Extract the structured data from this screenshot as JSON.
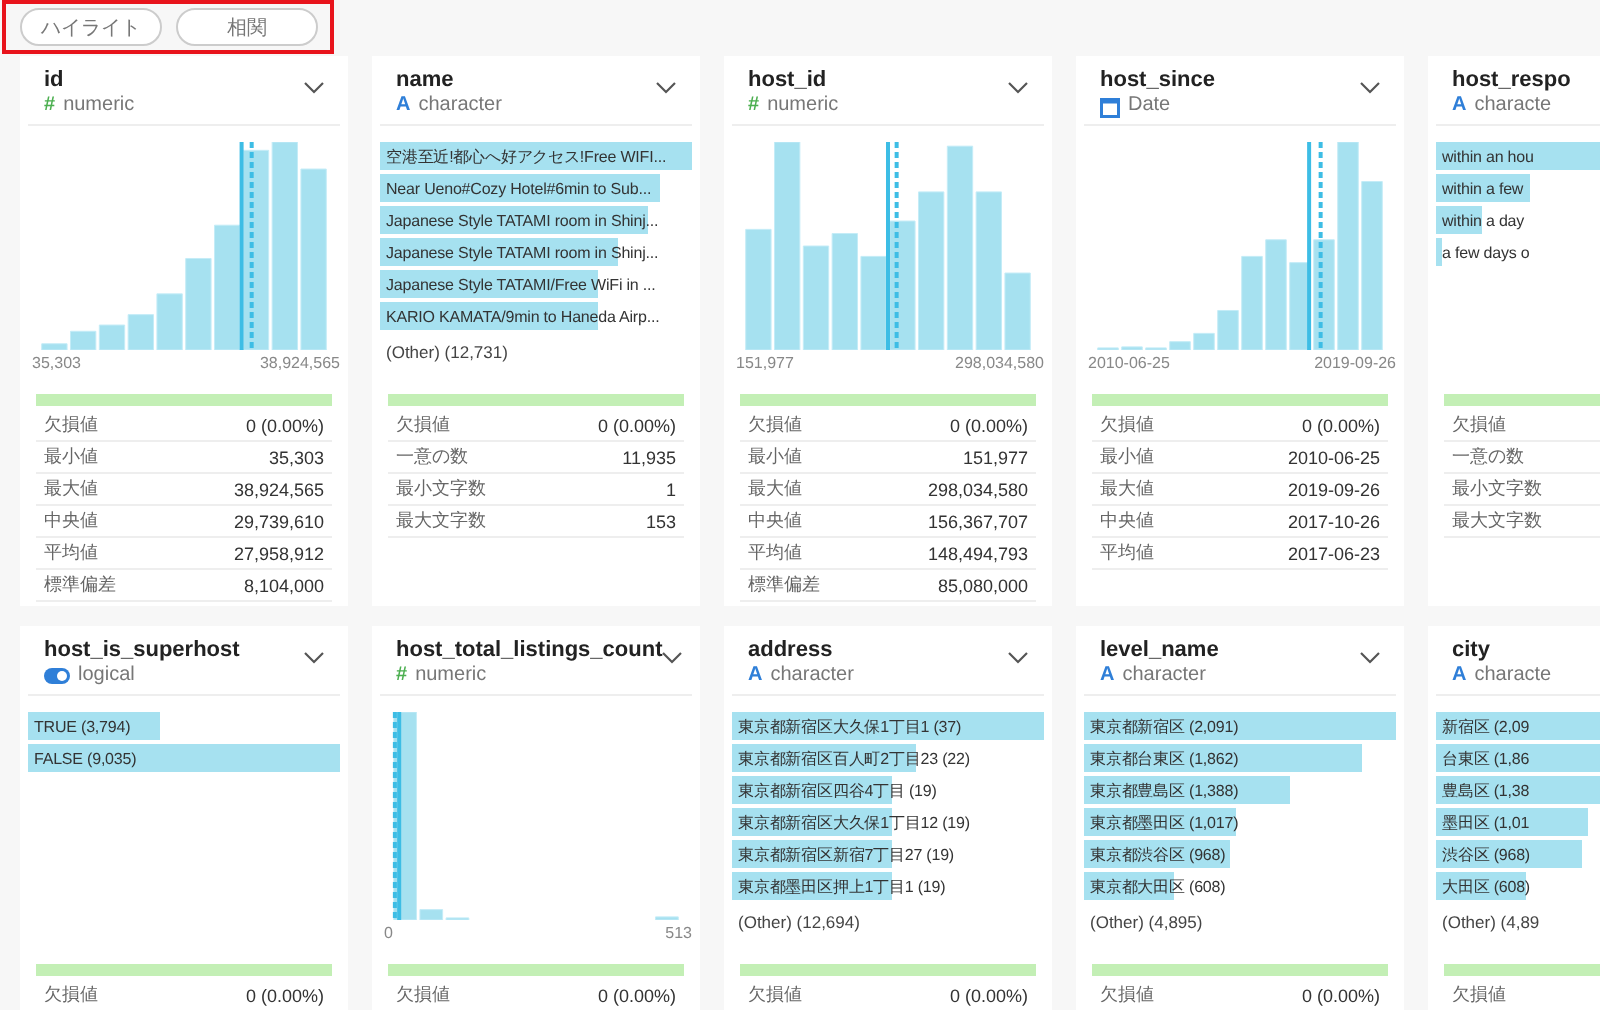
{
  "toolbar": {
    "buttons": [
      {
        "label": "ハイライト"
      },
      {
        "label": "相関"
      }
    ]
  },
  "rows": [
    [
      {
        "name": "id",
        "type": {
          "kind": "numeric",
          "icon": "#",
          "label": "numeric"
        },
        "kind": "histogram",
        "histogram": {
          "min_label": "35,303",
          "max_label": "38,924,565"
        },
        "completeness": {
          "level": 1
        },
        "stats": [
          {
            "label": "欠損値",
            "value": "0 (0.00%)"
          },
          {
            "label": "最小値",
            "value": "35,303"
          },
          {
            "label": "最大値",
            "value": "38,924,565"
          },
          {
            "label": "中央値",
            "value": "29,739,610"
          },
          {
            "label": "平均値",
            "value": "27,958,912"
          },
          {
            "label": "標準偏差",
            "value": "8,104,000"
          }
        ]
      },
      {
        "name": "name",
        "type": {
          "kind": "character",
          "icon": "A",
          "label": "character"
        },
        "kind": "categories",
        "categories": [
          {
            "label": "空港至近!都心へ好アクセス!Free WIFI...",
            "level": 1
          },
          {
            "label": "Near Ueno#Cozy Hotel#6min to Sub...",
            "level": 0.9
          },
          {
            "label": "Japanese Style TATAMI room in Shinj...",
            "level": 0.86
          },
          {
            "label": "Japanese Style TATAMI room in Shinj...",
            "level": 0.76
          },
          {
            "label": "Japanese Style TATAMI/Free WiFi in ...",
            "level": 0.7
          },
          {
            "label": "KARIO KAMATA/9min to Haneda Airp...",
            "level": 0.7
          }
        ],
        "other": "(Other) (12,731)",
        "completeness": {
          "level": 1
        },
        "stats": [
          {
            "label": "欠損値",
            "value": "0 (0.00%)"
          },
          {
            "label": "一意の数",
            "value": "11,935"
          },
          {
            "label": "最小文字数",
            "value": "1"
          },
          {
            "label": "最大文字数",
            "value": "153"
          }
        ]
      },
      {
        "name": "host_id",
        "type": {
          "kind": "numeric",
          "icon": "#",
          "label": "numeric"
        },
        "kind": "histogram",
        "histogram": {
          "min_label": "151,977",
          "max_label": "298,034,580"
        },
        "completeness": {
          "level": 1
        },
        "stats": [
          {
            "label": "欠損値",
            "value": "0 (0.00%)"
          },
          {
            "label": "最小値",
            "value": "151,977"
          },
          {
            "label": "最大値",
            "value": "298,034,580"
          },
          {
            "label": "中央値",
            "value": "156,367,707"
          },
          {
            "label": "平均値",
            "value": "148,494,793"
          },
          {
            "label": "標準偏差",
            "value": "85,080,000"
          }
        ]
      },
      {
        "name": "host_since",
        "type": {
          "kind": "date",
          "label": "Date"
        },
        "kind": "histogram",
        "histogram": {
          "min_label": "2010-06-25",
          "max_label": "2019-09-26"
        },
        "completeness": {
          "level": 1
        },
        "stats": [
          {
            "label": "欠損値",
            "value": "0 (0.00%)"
          },
          {
            "label": "最小値",
            "value": "2010-06-25"
          },
          {
            "label": "最大値",
            "value": "2019-09-26"
          },
          {
            "label": "中央値",
            "value": "2017-10-26"
          },
          {
            "label": "平均値",
            "value": "2017-06-23"
          }
        ]
      },
      {
        "name": "host_respo",
        "type": {
          "kind": "character",
          "icon": "A",
          "label": "characte"
        },
        "kind": "categories",
        "categories": [
          {
            "label": "within an hou",
            "level": 1
          },
          {
            "label": "within a few",
            "level": 0.3
          },
          {
            "label": "within a day",
            "level": 0.15
          },
          {
            "label": "a few days o",
            "level": 0.02
          }
        ],
        "completeness": {
          "level": 1
        },
        "stats": [
          {
            "label": "欠損値"
          },
          {
            "label": "一意の数"
          },
          {
            "label": "最小文字数"
          },
          {
            "label": "最大文字数"
          }
        ]
      }
    ],
    [
      {
        "name": "host_is_superhost",
        "type": {
          "kind": "logical",
          "label": "logical"
        },
        "kind": "categories",
        "categories": [
          {
            "label": "TRUE (3,794)",
            "level": 0.42
          },
          {
            "label": "FALSE (9,035)",
            "level": 1
          }
        ],
        "completeness": {
          "level": 1
        },
        "stats": [
          {
            "label": "欠損値",
            "value": "0 (0.00%)"
          }
        ]
      },
      {
        "name": "host_total_listings_count",
        "type": {
          "kind": "numeric",
          "icon": "#",
          "label": "numeric"
        },
        "kind": "histogram",
        "histogram": {
          "min_label": "0",
          "max_label": "513"
        },
        "completeness": {
          "level": 1
        },
        "stats": [
          {
            "label": "欠損値",
            "value": "0 (0.00%)"
          }
        ]
      },
      {
        "name": "address",
        "type": {
          "kind": "character",
          "icon": "A",
          "label": "character"
        },
        "kind": "categories",
        "categories": [
          {
            "label": "東京都新宿区大久保1丁目1 (37)",
            "level": 1
          },
          {
            "label": "東京都新宿区百人町2丁目23 (22)",
            "level": 0.59
          },
          {
            "label": "東京都新宿区四谷4丁目 (19)",
            "level": 0.51
          },
          {
            "label": "東京都新宿区大久保1丁目12 (19)",
            "level": 0.51
          },
          {
            "label": "東京都新宿区新宿7丁目27 (19)",
            "level": 0.51
          },
          {
            "label": "東京都墨田区押上1丁目1 (19)",
            "level": 0.51
          }
        ],
        "other": "(Other) (12,694)",
        "completeness": {
          "level": 1
        },
        "stats": [
          {
            "label": "欠損値",
            "value": "0 (0.00%)"
          }
        ]
      },
      {
        "name": "level_name",
        "type": {
          "kind": "character",
          "icon": "A",
          "label": "character"
        },
        "kind": "categories",
        "categories": [
          {
            "label": "東京都新宿区 (2,091)",
            "level": 1
          },
          {
            "label": "東京都台東区 (1,862)",
            "level": 0.89
          },
          {
            "label": "東京都豊島区 (1,388)",
            "level": 0.66
          },
          {
            "label": "東京都墨田区 (1,017)",
            "level": 0.49
          },
          {
            "label": "東京都渋谷区 (968)",
            "level": 0.47
          },
          {
            "label": "東京都大田区 (608)",
            "level": 0.29
          }
        ],
        "other": "(Other) (4,895)",
        "completeness": {
          "level": 1
        },
        "stats": [
          {
            "label": "欠損値",
            "value": "0 (0.00%)"
          }
        ]
      },
      {
        "name": "city",
        "type": {
          "kind": "character",
          "icon": "A",
          "label": "characte"
        },
        "kind": "categories",
        "categories": [
          {
            "label": "新宿区 (2,09",
            "level": 1
          },
          {
            "label": "台東区 (1,86",
            "level": 0.89
          },
          {
            "label": "豊島区 (1,38",
            "level": 0.66
          },
          {
            "label": "墨田区 (1,01",
            "level": 0.49
          },
          {
            "label": "渋谷区 (968)",
            "level": 0.47
          },
          {
            "label": "大田区 (608)",
            "level": 0.29
          }
        ],
        "other": "(Other) (4,89",
        "completeness": {
          "level": 1
        },
        "stats": [
          {
            "label": "欠損値"
          }
        ]
      }
    ]
  ]
}
